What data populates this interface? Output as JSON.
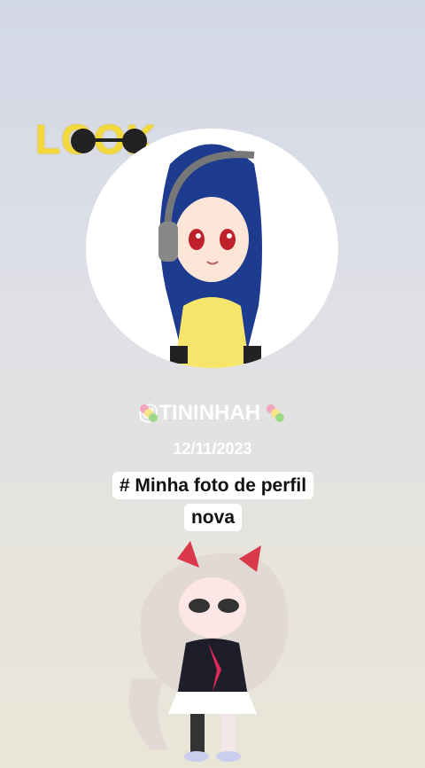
{
  "overlay": {
    "look_text": "LOOK"
  },
  "profile": {
    "username": "@TININHAH",
    "date": "12/11/2023",
    "caption": "# Minha foto de perfil nova"
  },
  "icons": {
    "candy": "dango-icon",
    "glasses": "sunglasses-icon"
  },
  "colors": {
    "look_yellow": "#f4d93a",
    "hair_blue": "#1d3b8f",
    "shirt_yellow": "#f6e56b"
  }
}
